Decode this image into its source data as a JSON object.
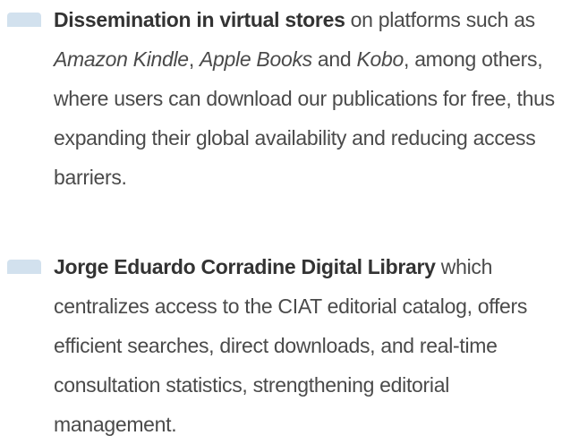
{
  "items": [
    {
      "lead": "Dissemination in virtual stores",
      "parts": [
        {
          "t": " on platforms such as ",
          "i": false
        },
        {
          "t": "Amazon Kindle",
          "i": true
        },
        {
          "t": ", ",
          "i": false
        },
        {
          "t": "Apple Books",
          "i": true
        },
        {
          "t": " and ",
          "i": false
        },
        {
          "t": "Kobo",
          "i": true
        },
        {
          "t": ", among others, where users can download our publications for free, thus expanding their global availability and reducing access barriers.",
          "i": false
        }
      ]
    },
    {
      "lead": "Jorge Eduardo Corradine Digital Library",
      "parts": [
        {
          "t": " which centralizes access to the CIAT editorial catalog, offers efficient searches, direct downloads, and real-time consultation statistics, strengthening editorial management.",
          "i": false
        }
      ]
    }
  ],
  "colors": {
    "marker": "#d2e1ee",
    "text": "#4a4a4a",
    "lead": "#333333"
  }
}
